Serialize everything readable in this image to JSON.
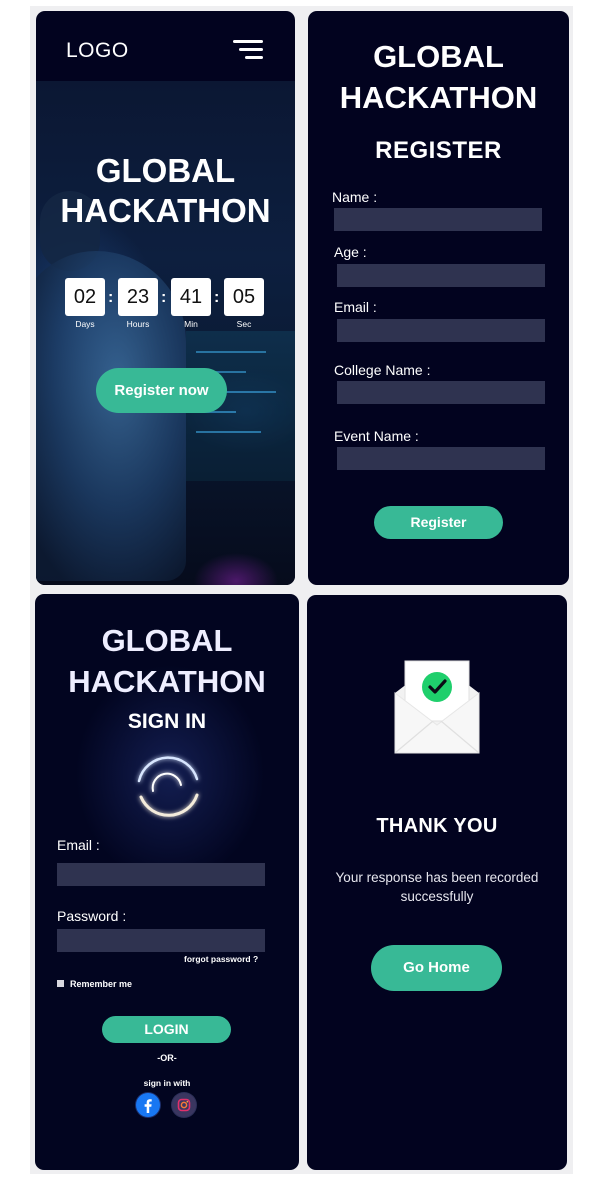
{
  "colors": {
    "panel_bg": "#02031f",
    "accent": "#38b996",
    "field_bg": "#2f3350",
    "page_bg": "#efeff1"
  },
  "landing": {
    "logo": "LOGO",
    "menu_icon": "hamburger-menu-icon",
    "title_line1": "GLOBAL",
    "title_line2": "HACKATHON",
    "countdown": [
      {
        "value": "02",
        "unit": "Days"
      },
      {
        "value": "23",
        "unit": "Hours"
      },
      {
        "value": "41",
        "unit": "Min"
      },
      {
        "value": "05",
        "unit": "Sec"
      }
    ],
    "separator": ":",
    "register_button": "Register now"
  },
  "register": {
    "title_line1": "GLOBAL",
    "title_line2": "HACKATHON",
    "heading": "REGISTER",
    "fields": [
      {
        "label": "Name :",
        "value": ""
      },
      {
        "label": "Age :",
        "value": ""
      },
      {
        "label": "Email :",
        "value": ""
      },
      {
        "label": "College Name :",
        "value": ""
      },
      {
        "label": "Event Name :",
        "value": ""
      }
    ],
    "submit_button": "Register"
  },
  "signin": {
    "title_line1": "GLOBAL",
    "title_line2": "HACKATHON",
    "heading": "SIGN IN",
    "email_label": "Email :",
    "password_label": "Password :",
    "forgot_password": "forgot password ?",
    "remember_me": "Remember me",
    "login_button": "LOGIN",
    "or_divider": "-OR-",
    "social_prompt": "sign in with",
    "social_icons": [
      "facebook-icon",
      "instagram-icon"
    ]
  },
  "thankyou": {
    "icon": "envelope-check-icon",
    "heading": "THANK YOU",
    "message": "Your response has been recorded successfully",
    "home_button": "Go Home"
  }
}
